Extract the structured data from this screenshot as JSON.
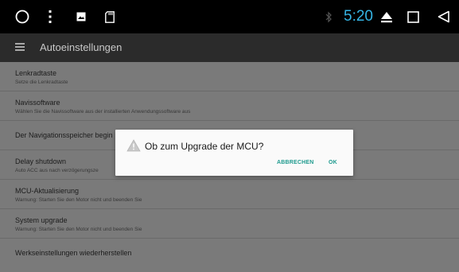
{
  "status_bar": {
    "time": "5:20",
    "icons": [
      "circle-home-icon",
      "more-vert-icon",
      "image-icon",
      "sd-card-icon",
      "bluetooth-icon",
      "eject-icon",
      "recents-square-icon",
      "back-triangle-icon"
    ]
  },
  "app_bar": {
    "title": "Autoeinstellungen"
  },
  "settings": [
    {
      "title": "Lenkradtaste",
      "subtitle": "Setze die Lenkradtaste"
    },
    {
      "title": "Navissoftware",
      "subtitle": "Wählen Sie die Navissoftware aus der installierten Anwendungssoftware aus"
    },
    {
      "title": "Der Navigationsspeicher begin",
      "subtitle": ""
    },
    {
      "title": "Delay shutdown",
      "subtitle": "Auto ACC aus nach verzögerungsze"
    },
    {
      "title": "MCU-Aktualisierung",
      "subtitle": "Warnung: Starten Sie den Motor nicht und beenden Sie"
    },
    {
      "title": "System upgrade",
      "subtitle": "Warnung: Starten Sie den Motor nicht und beenden Sie"
    },
    {
      "title": "Werkseinstellungen wiederherstellen",
      "subtitle": ""
    }
  ],
  "dialog": {
    "title": "Ob zum Upgrade der MCU?",
    "cancel_label": "ABBRECHEN",
    "ok_label": "OK",
    "accent_color": "#1e9a8e"
  }
}
